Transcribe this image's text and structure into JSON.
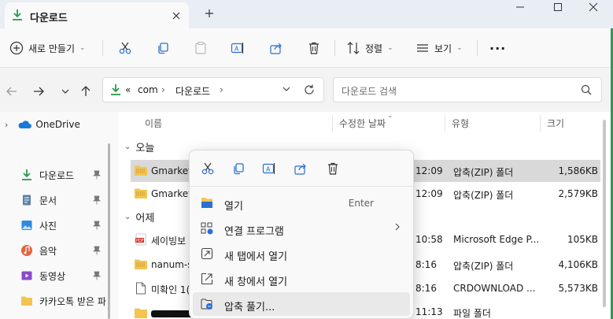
{
  "tab": {
    "title": "다운로드"
  },
  "toolbar": {
    "new_label": "새로 만들기",
    "sort_label": "정렬",
    "view_label": "보기",
    "more_label": "···"
  },
  "address": {
    "overflow": "«",
    "segment1": "com",
    "segment2": "다운로드"
  },
  "search": {
    "placeholder": "다운로드 검색"
  },
  "navpane": {
    "onedrive": "OneDrive",
    "items": [
      "다운로드",
      "문서",
      "사진",
      "음악",
      "동영상",
      "카카오톡 받은 파"
    ]
  },
  "columns": {
    "name": "이름",
    "modified": "수정한 날짜",
    "type": "유형",
    "size": "크기"
  },
  "groups": {
    "today": "오늘",
    "yesterday": "어제"
  },
  "rows": [
    {
      "name": "GmarketS",
      "time": "12:09",
      "type": "압축(ZIP) 폴더",
      "size": "1,586KB"
    },
    {
      "name": "GmarketS",
      "time": "12:09",
      "type": "압축(ZIP) 폴더",
      "size": "2,579KB"
    },
    {
      "name": "세이빙보",
      "time": "10:58",
      "type": "Microsoft Edge P...",
      "size": "105KB"
    },
    {
      "name": "nanum-s",
      "time": "8:16",
      "type": "압축(ZIP) 폴더",
      "size": "4,106KB"
    },
    {
      "name": "미확인 1(",
      "time": "8:16",
      "type": "CRDOWNLOAD ...",
      "size": "5,573KB"
    },
    {
      "name": "",
      "time": "11:13",
      "type": "파일 폴더",
      "size": ""
    }
  ],
  "context_menu": {
    "items": [
      {
        "label": "열기",
        "accel": "Enter"
      },
      {
        "label": "연결 프로그램",
        "accel": ""
      },
      {
        "label": "새 탭에서 열기",
        "accel": ""
      },
      {
        "label": "새 창에서 열기",
        "accel": ""
      },
      {
        "label": "압축 풀기...",
        "accel": ""
      }
    ]
  },
  "colors": {
    "accent": "#0067c0",
    "folder": "#f4c44e",
    "green": "#2a9b4a"
  }
}
